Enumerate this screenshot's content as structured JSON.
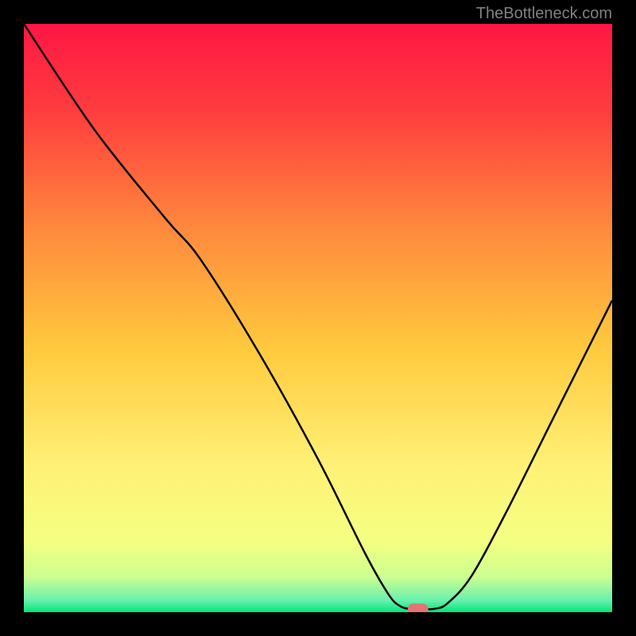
{
  "attribution": "TheBottleneck.com",
  "chart_data": {
    "type": "line",
    "title": "",
    "xlabel": "",
    "ylabel": "",
    "xlim": [
      0,
      100
    ],
    "ylim": [
      0,
      100
    ],
    "background_gradient": {
      "stops": [
        {
          "offset": 0,
          "color": "#ff1744"
        },
        {
          "offset": 15,
          "color": "#ff3d3d"
        },
        {
          "offset": 35,
          "color": "#ff8a3d"
        },
        {
          "offset": 55,
          "color": "#ffc93d"
        },
        {
          "offset": 75,
          "color": "#fff176"
        },
        {
          "offset": 88,
          "color": "#f4ff81"
        },
        {
          "offset": 94,
          "color": "#ccff90"
        },
        {
          "offset": 98,
          "color": "#69f0ae"
        },
        {
          "offset": 100,
          "color": "#00e676"
        }
      ]
    },
    "series": [
      {
        "name": "bottleneck-curve",
        "color": "#000000",
        "points": [
          {
            "x": 0,
            "y": 100
          },
          {
            "x": 12,
            "y": 82
          },
          {
            "x": 24,
            "y": 67
          },
          {
            "x": 30,
            "y": 60
          },
          {
            "x": 40,
            "y": 44
          },
          {
            "x": 50,
            "y": 26
          },
          {
            "x": 58,
            "y": 10
          },
          {
            "x": 62,
            "y": 3
          },
          {
            "x": 64,
            "y": 1
          },
          {
            "x": 66,
            "y": 0.5
          },
          {
            "x": 68,
            "y": 0.5
          },
          {
            "x": 70,
            "y": 0.6
          },
          {
            "x": 72,
            "y": 1.5
          },
          {
            "x": 76,
            "y": 6
          },
          {
            "x": 82,
            "y": 17
          },
          {
            "x": 90,
            "y": 33
          },
          {
            "x": 100,
            "y": 53
          }
        ]
      }
    ],
    "marker": {
      "x": 67,
      "y": 0.5,
      "color": "#e57373"
    }
  }
}
